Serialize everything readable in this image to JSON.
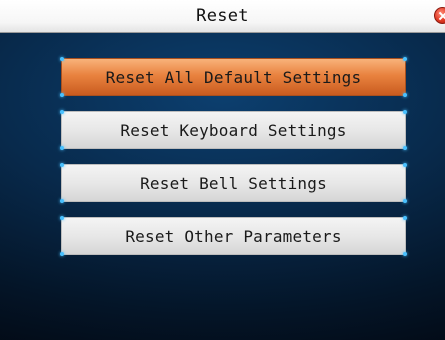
{
  "window": {
    "title": "Reset",
    "close_icon": "close-icon"
  },
  "menu": {
    "selected_index": 0,
    "items": [
      {
        "label": "Reset All Default Settings"
      },
      {
        "label": "Reset Keyboard Settings"
      },
      {
        "label": "Reset Bell Settings"
      },
      {
        "label": "Reset Other Parameters"
      }
    ]
  },
  "colors": {
    "title_bar": "#f4f4f4",
    "background": "#082a4c",
    "selected_item": "#e9823f",
    "item": "#e6e6e6",
    "corner_accent": "#49c1ff",
    "close_icon": "#e23a24"
  }
}
